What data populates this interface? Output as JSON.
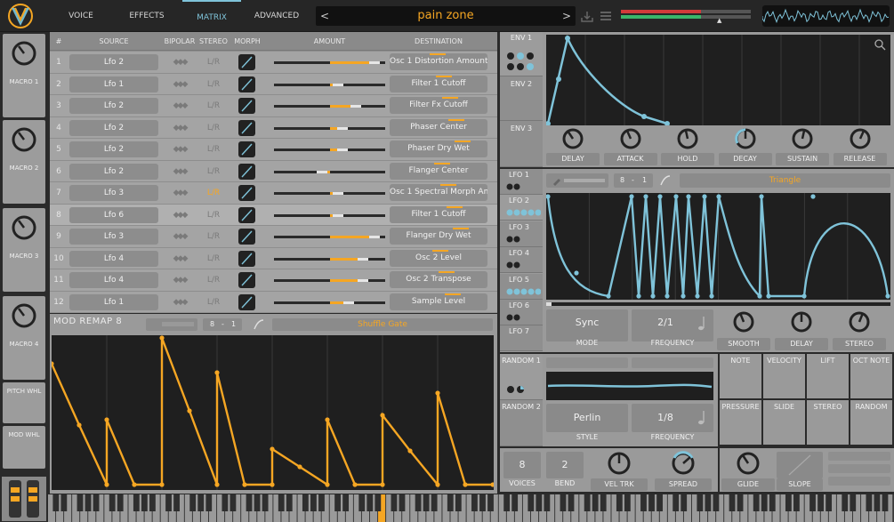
{
  "header": {
    "tabs": [
      {
        "label": "VOICE"
      },
      {
        "label": "EFFECTS"
      },
      {
        "label": "MATRIX"
      },
      {
        "label": "ADVANCED"
      }
    ],
    "preset_name": "pain zone",
    "prev_glyph": "<",
    "next_glyph": ">",
    "active_tab_color": "#7fc3d9",
    "accent_color": "#f5a623"
  },
  "sidebar": {
    "macros": [
      {
        "label": "MACRO 1"
      },
      {
        "label": "MACRO 2"
      },
      {
        "label": "MACRO 3"
      },
      {
        "label": "MACRO 4"
      }
    ],
    "pitch_label": "PITCH WHL",
    "mod_label": "MOD WHL"
  },
  "matrix": {
    "headers": {
      "num": "#",
      "source": "SOURCE",
      "bipolar": "BIPOLAR",
      "stereo": "STEREO",
      "morph": "MORPH",
      "amount": "AMOUNT",
      "destination": "DESTINATION"
    },
    "bipolar_glyph": "◆◆◆",
    "stereo_text": "L/R",
    "rows": [
      {
        "num": "1",
        "source": "Lfo 2",
        "stereo_on": false,
        "amount": 0.95,
        "destination": "Osc 1 Distortion Amount"
      },
      {
        "num": "2",
        "source": "Lfo 1",
        "stereo_on": false,
        "amount": 0.62,
        "destination": "Filter 1 Cutoff"
      },
      {
        "num": "3",
        "source": "Lfo 2",
        "stereo_on": false,
        "amount": 0.78,
        "destination": "Filter Fx Cutoff"
      },
      {
        "num": "4",
        "source": "Lfo 2",
        "stereo_on": false,
        "amount": 0.66,
        "destination": "Phaser Center"
      },
      {
        "num": "5",
        "source": "Lfo 2",
        "stereo_on": false,
        "amount": 0.66,
        "destination": "Phaser Dry Wet"
      },
      {
        "num": "6",
        "source": "Lfo 2",
        "stereo_on": false,
        "amount": 0.38,
        "destination": "Flanger Center"
      },
      {
        "num": "7",
        "source": "Lfo 3",
        "stereo_on": true,
        "amount": 0.62,
        "destination": "Osc 1 Spectral Morph Am"
      },
      {
        "num": "8",
        "source": "Lfo 6",
        "stereo_on": false,
        "amount": 0.62,
        "destination": "Filter 1 Cutoff"
      },
      {
        "num": "9",
        "source": "Lfo 3",
        "stereo_on": false,
        "amount": 0.95,
        "destination": "Flanger Dry Wet"
      },
      {
        "num": "10",
        "source": "Lfo 4",
        "stereo_on": false,
        "amount": 0.85,
        "destination": "Osc 2 Level"
      },
      {
        "num": "11",
        "source": "Lfo 4",
        "stereo_on": false,
        "amount": 0.85,
        "destination": "Osc 2 Transpose"
      },
      {
        "num": "12",
        "source": "Lfo 1",
        "stereo_on": false,
        "amount": 0.72,
        "destination": "Sample Level"
      }
    ]
  },
  "remap": {
    "title": "MOD REMAP 8",
    "grid_a": "8",
    "grid_b": "1",
    "preset": "Shuffle Gate"
  },
  "env": {
    "tabs": [
      {
        "label": "ENV 1"
      },
      {
        "label": "ENV 2"
      },
      {
        "label": "ENV 3"
      }
    ],
    "knobs": [
      {
        "label": "DELAY"
      },
      {
        "label": "ATTACK"
      },
      {
        "label": "HOLD"
      },
      {
        "label": "DECAY"
      },
      {
        "label": "SUSTAIN"
      },
      {
        "label": "RELEASE"
      }
    ]
  },
  "lfo": {
    "tabs": [
      {
        "label": "LFO 1"
      },
      {
        "label": "LFO 2"
      },
      {
        "label": "LFO 3"
      },
      {
        "label": "LFO 4"
      },
      {
        "label": "LFO 5"
      },
      {
        "label": "LFO 6"
      },
      {
        "label": "LFO 7"
      }
    ],
    "grid_a": "8",
    "grid_b": "1",
    "preset": "Triangle",
    "mode_value": "Sync",
    "mode_label": "MODE",
    "freq_value": "2/1",
    "freq_label": "FREQUENCY",
    "knobs": [
      {
        "label": "SMOOTH"
      },
      {
        "label": "DELAY"
      },
      {
        "label": "STEREO"
      }
    ]
  },
  "random": {
    "tabs": [
      {
        "label": "RANDOM 1"
      },
      {
        "label": "RANDOM 2"
      }
    ],
    "style_value": "Perlin",
    "style_label": "STYLE",
    "freq_value": "1/8",
    "freq_label": "FREQUENCY"
  },
  "keytrack": {
    "cells": [
      {
        "label": "NOTE"
      },
      {
        "label": "VELOCITY"
      },
      {
        "label": "LIFT"
      },
      {
        "label": "OCT NOTE"
      },
      {
        "label": "PRESSURE"
      },
      {
        "label": "SLIDE"
      },
      {
        "label": "STEREO"
      },
      {
        "label": "RANDOM"
      }
    ]
  },
  "voice": {
    "voices_value": "8",
    "voices_label": "VOICES",
    "bend_value": "2",
    "bend_label": "BEND",
    "veltrk_label": "VEL TRK",
    "spread_label": "SPREAD",
    "glide_label": "GLIDE",
    "slope_label": "SLOPE"
  }
}
